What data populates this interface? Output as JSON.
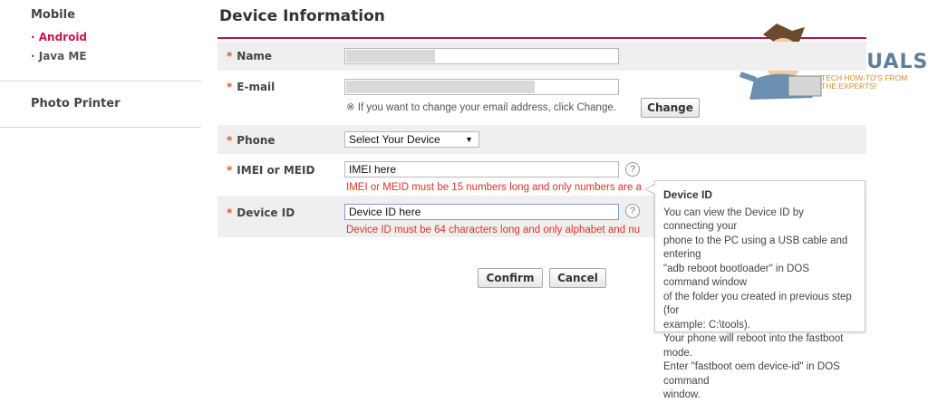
{
  "sidebar": {
    "sections": [
      {
        "heading": "Mobile",
        "items": [
          {
            "label": "· Android",
            "active": true
          },
          {
            "label": "· Java ME",
            "active": false
          }
        ]
      },
      {
        "heading": "Photo Printer",
        "items": []
      }
    ]
  },
  "main": {
    "title": "Device Information",
    "fields": {
      "name": {
        "label": "Name",
        "value": ""
      },
      "email": {
        "label": "E-mail",
        "value": "",
        "hint": "※ If you want to change your email address, click Change.",
        "change_label": "Change"
      },
      "phone": {
        "label": "Phone",
        "selected": "Select Your Device"
      },
      "imei": {
        "label": "IMEI or MEID",
        "value": "IMEI here",
        "error": "IMEI or MEID must be 15 numbers long and only numbers are a"
      },
      "device_id": {
        "label": "Device ID",
        "value": "Device ID here",
        "error": "Device ID must be 64 characters long and only alphabet and nu"
      }
    },
    "required_mark": "*",
    "help_glyph": "?",
    "confirm_label": "Confirm",
    "cancel_label": "Cancel"
  },
  "tooltip": {
    "title": "Device ID",
    "body_lines": [
      "You can view the Device ID by connecting your",
      "phone to the PC using a USB cable and entering",
      "\"adb reboot bootloader\" in DOS command window",
      "of the folder you created in previous step (for",
      "example: C:\\tools).",
      "Your phone will reboot into the fastboot mode.",
      "Enter \"fastboot oem device-id\" in DOS command",
      "window."
    ]
  },
  "watermark": {
    "brand": "APPUALS",
    "tagline_1": "TECH HOW-TO'S FROM",
    "tagline_2": "THE EXPERTS!"
  },
  "colors": {
    "accent": "#c6174f",
    "error": "#e0312a",
    "required": "#e05a1a",
    "row_bg": "#efefef"
  }
}
